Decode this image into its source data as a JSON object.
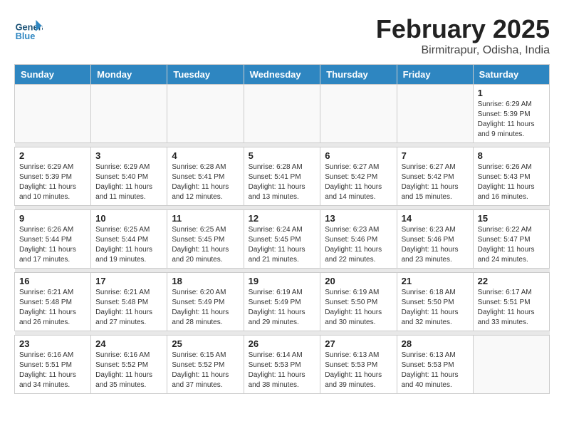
{
  "header": {
    "logo_general": "General",
    "logo_blue": "Blue",
    "month_title": "February 2025",
    "location": "Birmitrapur, Odisha, India"
  },
  "days_of_week": [
    "Sunday",
    "Monday",
    "Tuesday",
    "Wednesday",
    "Thursday",
    "Friday",
    "Saturday"
  ],
  "weeks": [
    [
      {
        "day": "",
        "info": ""
      },
      {
        "day": "",
        "info": ""
      },
      {
        "day": "",
        "info": ""
      },
      {
        "day": "",
        "info": ""
      },
      {
        "day": "",
        "info": ""
      },
      {
        "day": "",
        "info": ""
      },
      {
        "day": "1",
        "info": "Sunrise: 6:29 AM\nSunset: 5:39 PM\nDaylight: 11 hours and 9 minutes."
      }
    ],
    [
      {
        "day": "2",
        "info": "Sunrise: 6:29 AM\nSunset: 5:39 PM\nDaylight: 11 hours and 10 minutes."
      },
      {
        "day": "3",
        "info": "Sunrise: 6:29 AM\nSunset: 5:40 PM\nDaylight: 11 hours and 11 minutes."
      },
      {
        "day": "4",
        "info": "Sunrise: 6:28 AM\nSunset: 5:41 PM\nDaylight: 11 hours and 12 minutes."
      },
      {
        "day": "5",
        "info": "Sunrise: 6:28 AM\nSunset: 5:41 PM\nDaylight: 11 hours and 13 minutes."
      },
      {
        "day": "6",
        "info": "Sunrise: 6:27 AM\nSunset: 5:42 PM\nDaylight: 11 hours and 14 minutes."
      },
      {
        "day": "7",
        "info": "Sunrise: 6:27 AM\nSunset: 5:42 PM\nDaylight: 11 hours and 15 minutes."
      },
      {
        "day": "8",
        "info": "Sunrise: 6:26 AM\nSunset: 5:43 PM\nDaylight: 11 hours and 16 minutes."
      }
    ],
    [
      {
        "day": "9",
        "info": "Sunrise: 6:26 AM\nSunset: 5:44 PM\nDaylight: 11 hours and 17 minutes."
      },
      {
        "day": "10",
        "info": "Sunrise: 6:25 AM\nSunset: 5:44 PM\nDaylight: 11 hours and 19 minutes."
      },
      {
        "day": "11",
        "info": "Sunrise: 6:25 AM\nSunset: 5:45 PM\nDaylight: 11 hours and 20 minutes."
      },
      {
        "day": "12",
        "info": "Sunrise: 6:24 AM\nSunset: 5:45 PM\nDaylight: 11 hours and 21 minutes."
      },
      {
        "day": "13",
        "info": "Sunrise: 6:23 AM\nSunset: 5:46 PM\nDaylight: 11 hours and 22 minutes."
      },
      {
        "day": "14",
        "info": "Sunrise: 6:23 AM\nSunset: 5:46 PM\nDaylight: 11 hours and 23 minutes."
      },
      {
        "day": "15",
        "info": "Sunrise: 6:22 AM\nSunset: 5:47 PM\nDaylight: 11 hours and 24 minutes."
      }
    ],
    [
      {
        "day": "16",
        "info": "Sunrise: 6:21 AM\nSunset: 5:48 PM\nDaylight: 11 hours and 26 minutes."
      },
      {
        "day": "17",
        "info": "Sunrise: 6:21 AM\nSunset: 5:48 PM\nDaylight: 11 hours and 27 minutes."
      },
      {
        "day": "18",
        "info": "Sunrise: 6:20 AM\nSunset: 5:49 PM\nDaylight: 11 hours and 28 minutes."
      },
      {
        "day": "19",
        "info": "Sunrise: 6:19 AM\nSunset: 5:49 PM\nDaylight: 11 hours and 29 minutes."
      },
      {
        "day": "20",
        "info": "Sunrise: 6:19 AM\nSunset: 5:50 PM\nDaylight: 11 hours and 30 minutes."
      },
      {
        "day": "21",
        "info": "Sunrise: 6:18 AM\nSunset: 5:50 PM\nDaylight: 11 hours and 32 minutes."
      },
      {
        "day": "22",
        "info": "Sunrise: 6:17 AM\nSunset: 5:51 PM\nDaylight: 11 hours and 33 minutes."
      }
    ],
    [
      {
        "day": "23",
        "info": "Sunrise: 6:16 AM\nSunset: 5:51 PM\nDaylight: 11 hours and 34 minutes."
      },
      {
        "day": "24",
        "info": "Sunrise: 6:16 AM\nSunset: 5:52 PM\nDaylight: 11 hours and 35 minutes."
      },
      {
        "day": "25",
        "info": "Sunrise: 6:15 AM\nSunset: 5:52 PM\nDaylight: 11 hours and 37 minutes."
      },
      {
        "day": "26",
        "info": "Sunrise: 6:14 AM\nSunset: 5:53 PM\nDaylight: 11 hours and 38 minutes."
      },
      {
        "day": "27",
        "info": "Sunrise: 6:13 AM\nSunset: 5:53 PM\nDaylight: 11 hours and 39 minutes."
      },
      {
        "day": "28",
        "info": "Sunrise: 6:13 AM\nSunset: 5:53 PM\nDaylight: 11 hours and 40 minutes."
      },
      {
        "day": "",
        "info": ""
      }
    ]
  ]
}
